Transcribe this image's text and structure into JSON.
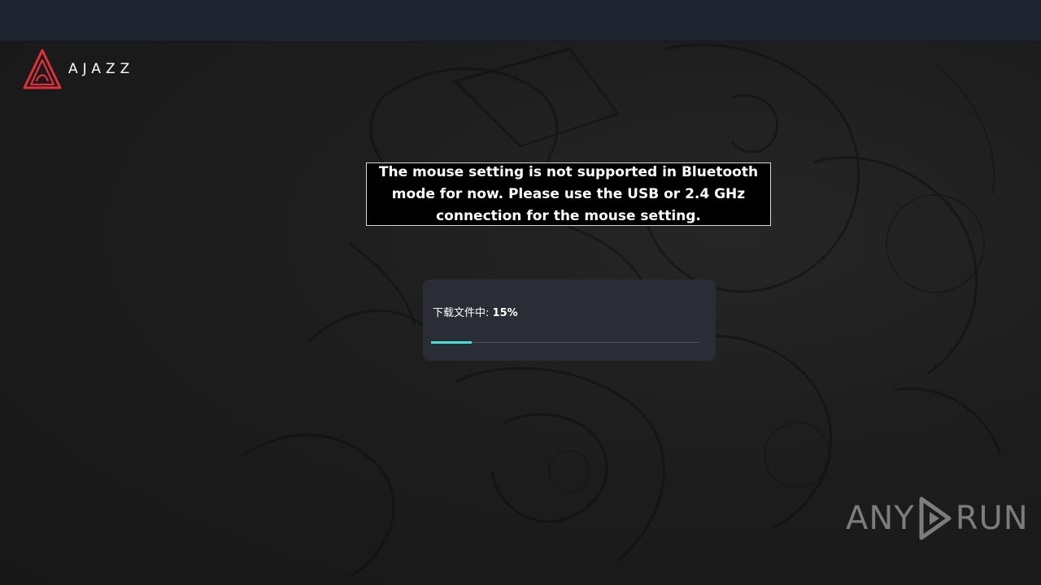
{
  "brand": {
    "name": "AJAZZ",
    "accent_color": "#e0303a"
  },
  "dialog": {
    "message": "The mouse setting is not supported in Bluetooth mode for now. Please use the USB or 2.4 GHz connection for the mouse setting."
  },
  "download": {
    "label": "下载文件中:",
    "percent_text": "15%",
    "progress": 0.15,
    "fill_color": "#43e0d4"
  },
  "watermark": {
    "left": "ANY",
    "right": "RUN"
  }
}
